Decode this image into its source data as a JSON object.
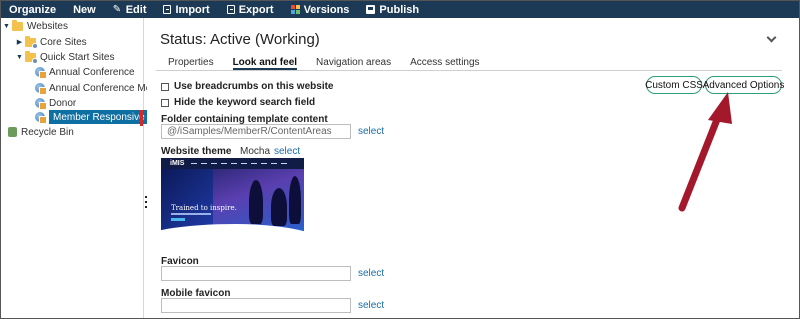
{
  "toolbar": {
    "items": [
      {
        "label": "Organize",
        "icon": ""
      },
      {
        "label": "New",
        "icon": ""
      },
      {
        "label": "Edit",
        "icon": "pencil-icon"
      },
      {
        "label": "Import",
        "icon": "import-icon"
      },
      {
        "label": "Export",
        "icon": "export-icon"
      },
      {
        "label": "Versions",
        "icon": "versions-icon"
      },
      {
        "label": "Publish",
        "icon": "publish-icon"
      }
    ],
    "background": "#1c3a55"
  },
  "tree": {
    "root": "Websites",
    "core_sites": "Core Sites",
    "quick_start": "Quick Start Sites",
    "sites": [
      "Annual Conference",
      "Annual Conference Mobile",
      "Donor",
      "Member Responsive"
    ],
    "recycle": "Recycle Bin",
    "selected_color": "#0e6fa3"
  },
  "main": {
    "status_title": "Status: Active (Working)",
    "tabs": [
      "Properties",
      "Look and feel",
      "Navigation areas",
      "Access settings"
    ],
    "active_tab": "Look and feel",
    "use_breadcrumbs": "Use breadcrumbs on this website",
    "hide_search": "Hide the keyword search field",
    "custom_css": "Custom CSS",
    "advanced_options": "Advanced Options",
    "folder_label": "Folder containing template content",
    "folder_value": "@/iSamples/MemberR/ContentAreas",
    "select": "select",
    "theme_label": "Website theme",
    "theme_value": "Mocha",
    "thumbnail": {
      "brand": "iMIS",
      "tagline": "Trained to inspire."
    },
    "favicon_label": "Favicon",
    "favicon_value": "",
    "mobile_favicon_label": "Mobile favicon",
    "mobile_favicon_value": "",
    "pill_border_color": "#2e9e7d",
    "link_color": "#1a6ca8"
  },
  "annotation": {
    "arrow_color": "#a3182b"
  }
}
